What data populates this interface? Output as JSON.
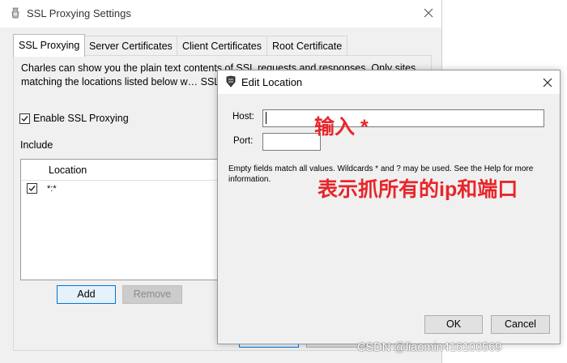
{
  "parent": {
    "title": "SSL Proxying Settings",
    "tabs": [
      {
        "label": "SSL Proxying"
      },
      {
        "label": "Server Certificates"
      },
      {
        "label": "Client Certificates"
      },
      {
        "label": "Root Certificate"
      }
    ],
    "description": "Charles can show you the plain text contents of SSL requests and responses. Only sites matching the locations listed below w… SSL certificates, please press the Help but…",
    "enable_ssl_label": "Enable SSL Proxying",
    "enable_ssl_checked": true,
    "include_label": "Include",
    "table": {
      "column_header": "Location",
      "rows": [
        {
          "checked": true,
          "location": "*:*"
        }
      ]
    },
    "add_label": "Add",
    "remove_label": "Remove"
  },
  "dialog": {
    "title": "Edit Location",
    "host_label": "Host:",
    "host_value": "",
    "port_label": "Port:",
    "port_value": "",
    "help_text": "Empty fields match all values. Wildcards * and ? may be used. See the Help for more information.",
    "ok_label": "OK",
    "cancel_label": "Cancel"
  },
  "annotations": {
    "input_hint": "输入 *",
    "explanation": "表示抓所有的ip和端口",
    "color": "#e8262a"
  },
  "watermark": "CSDN @liaomin416100569"
}
